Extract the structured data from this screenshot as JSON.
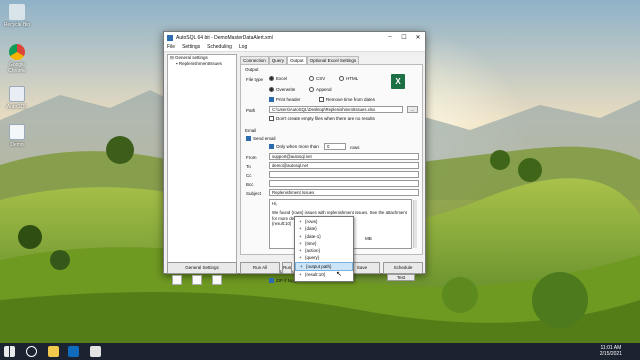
{
  "desktop": {
    "icons": [
      {
        "label": "Recycle Bin",
        "icon": "recycle-bin-icon"
      },
      {
        "label": "Google Chrome",
        "icon": "chrome-icon"
      },
      {
        "label": "AutoSQL",
        "icon": "autosql-icon"
      },
      {
        "label": "Demo",
        "icon": "demo-icon"
      }
    ]
  },
  "window": {
    "title": "AutoSQL 64 bit - DemoMasterDataAlert.xml",
    "controls": [
      "–",
      "☐",
      "✕"
    ],
    "menu": [
      "File",
      "Settings",
      "Scheduling",
      "Log"
    ]
  },
  "tree": {
    "root": "General settings",
    "child": "ReplenishmentIssues"
  },
  "tabs": [
    "Connection",
    "Query",
    "Output",
    "Optional Excel Settings"
  ],
  "active_tab": "Output",
  "output": {
    "section": "Output",
    "file_type_label": "File type",
    "file_types": [
      "Excel",
      "CSV",
      "HTML"
    ],
    "selected_file_type": "Excel",
    "overwrite_label": "Overwrite",
    "append_label": "Append",
    "print_header_label": "Print header",
    "remove_time_label": "Remove time from dates",
    "path_label": "Path",
    "path_value": "C:\\Users\\AutoSQL\\Desktop\\ReplenishmentIssues.xlsx",
    "browse_label": "...",
    "dont_create_label": "Don't create empty files when there are no results"
  },
  "email": {
    "section": "Email",
    "send_email_label": "Send email",
    "only_when_label": "Only when more than",
    "only_when_value": "0",
    "rows_label": "rows",
    "from_label": "From",
    "from_value": "support@autosql.net",
    "to_label": "To",
    "to_value": "demo@autosql.net",
    "cc_label": "Cc",
    "cc_value": "",
    "bcc_label": "Bcc",
    "bcc_value": "",
    "subject_label": "Subject",
    "subject_value": "Replenishment Issues",
    "body_lines": [
      "Hi,",
      "",
      "We found {rows} issues with replenishment issues. See the attachment",
      "for more details, first 10 rows:",
      "{result:10}"
    ],
    "attach_label": "Attach output",
    "zip_label": "ZIP if bigger than",
    "mb_label": "MB",
    "test_label": "Test"
  },
  "bottom_buttons": [
    "General Settings",
    "Run All",
    "Run",
    "Save",
    "Schedule"
  ],
  "popup_items": [
    "{rows}",
    "{date}",
    "{date-1}",
    "{time}",
    "{action}",
    "{query}",
    "{output path}",
    "{result:10}"
  ],
  "popup_selected": "{output path}",
  "clock": {
    "time": "11:01 AM",
    "date": "2/15/2021"
  },
  "colors": {
    "excel": "#1d7044",
    "accent": "#2b6cb0"
  }
}
